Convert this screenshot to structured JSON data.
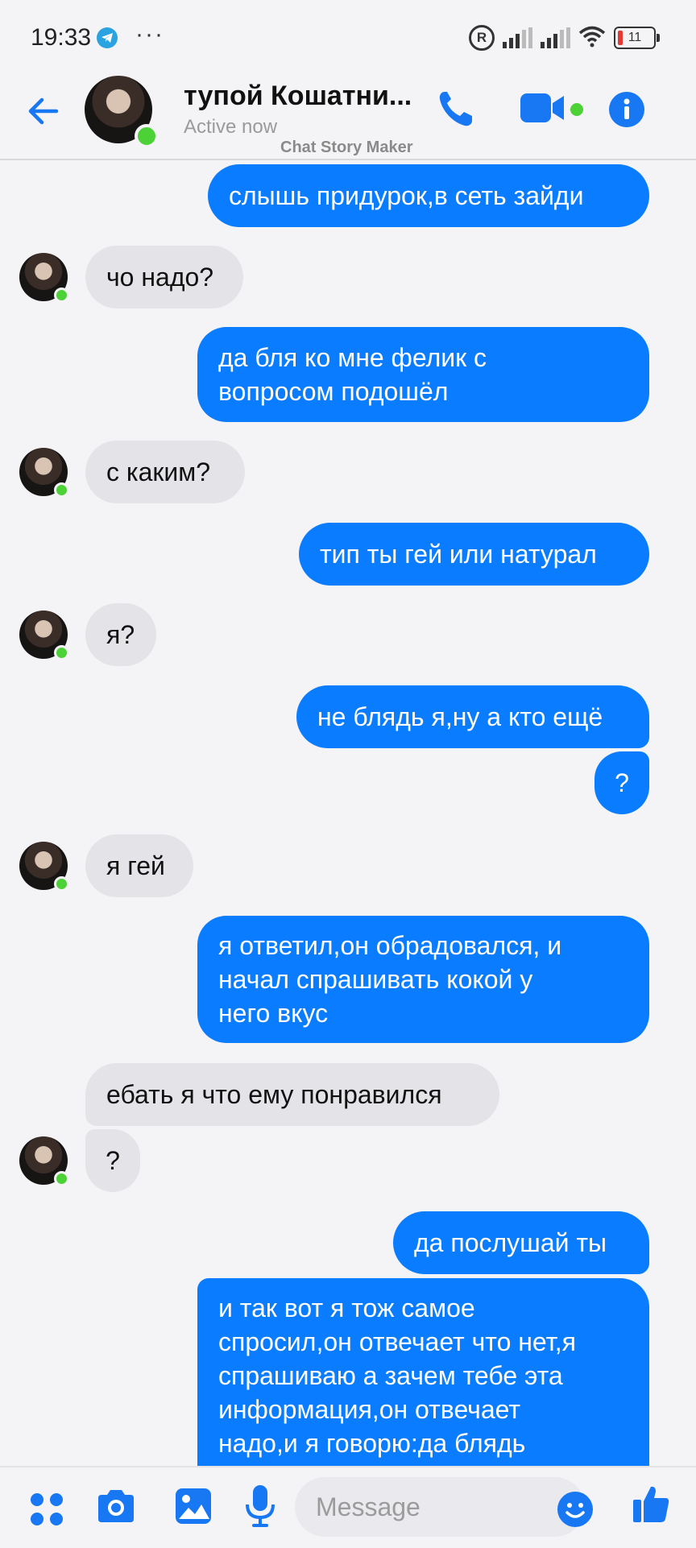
{
  "status_bar": {
    "time": "19:33",
    "battery": "11"
  },
  "header": {
    "contact_name": "тупой Кошатни...",
    "status": "Active now",
    "watermark": "Chat Story Maker"
  },
  "messages": [
    {
      "from": "me",
      "text": "слышь придурок,в сеть зайди"
    },
    {
      "from": "them",
      "text": "чо надо?"
    },
    {
      "from": "me",
      "text": "да бля ко мне фелик с\nвопросом подошёл"
    },
    {
      "from": "them",
      "text": "с каким?"
    },
    {
      "from": "me",
      "text": "тип ты гей или натурал"
    },
    {
      "from": "them",
      "text": "я?"
    },
    {
      "from": "me",
      "text": "не блядь я,ну а кто ещё"
    },
    {
      "from": "me",
      "text": "?"
    },
    {
      "from": "them",
      "text": "я гей"
    },
    {
      "from": "me",
      "text": "я ответил,он обрадовался, и\nначал спрашивать кокой у\nнего вкус"
    },
    {
      "from": "them",
      "text": "ебать я что ему понравился"
    },
    {
      "from": "them",
      "text": "?"
    },
    {
      "from": "me",
      "text": "да послушай ты"
    },
    {
      "from": "me",
      "text": "и так вот я тож самое\nспросил,он отвечает что нет,я\nспрашиваю а зачем тебе эта\nинформация,он отвечает\nнадо,и я говорю:да блядь"
    }
  ],
  "composer": {
    "placeholder": "Message"
  },
  "colors": {
    "accent": "#1877f2",
    "outgoing_bubble": "#0a7cff",
    "incoming_bubble": "#e4e4e8",
    "online_dot": "#4cd137"
  }
}
